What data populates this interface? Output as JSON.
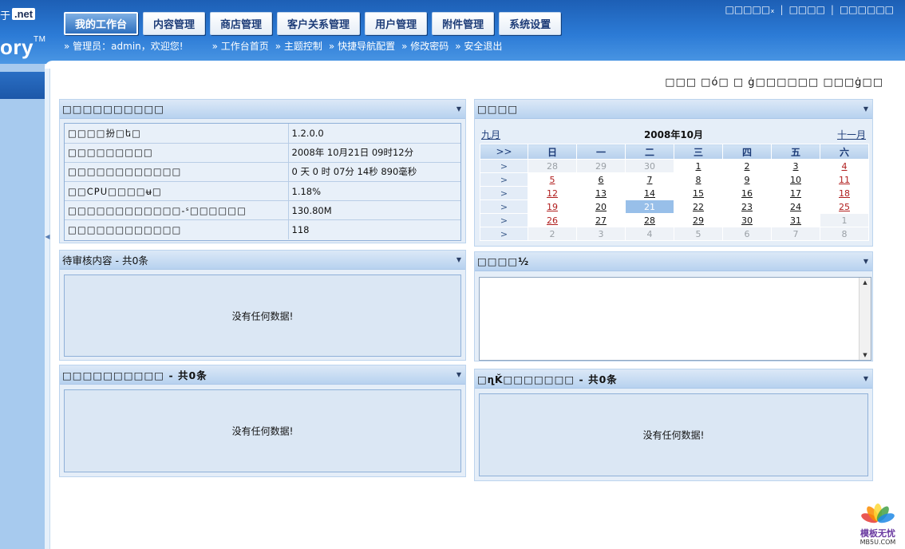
{
  "header": {
    "logo_char": "于",
    "logo_net": ".net",
    "logo_word": "ory",
    "logo_tm": "TM",
    "tabs": [
      {
        "label": "我的工作台",
        "active": true
      },
      {
        "label": "内容管理"
      },
      {
        "label": "商店管理"
      },
      {
        "label": "客户关系管理"
      },
      {
        "label": "用户管理"
      },
      {
        "label": "附件管理"
      },
      {
        "label": "系统设置"
      }
    ],
    "top_links": [
      "□□□□□ₓ",
      "□□□□",
      "□□□□□□"
    ],
    "greeting": "管理员：admin，欢迎您!",
    "sub_links": [
      "工作台首页",
      "主题控制",
      "快捷导航配置",
      "修改密码",
      "安全退出"
    ]
  },
  "top_right_info": "□□□ □ó□ □  ġ□□□□□□ □□□ġ□□",
  "system_info": {
    "title": "□□□□□□□□□□",
    "rows": [
      {
        "key": "□□□□扮□ե□",
        "value": "1.2.0.0"
      },
      {
        "key": "□□□□□□□□□",
        "value": "2008年 10月21日 09时12分"
      },
      {
        "key": "□□□□□□□□□□□□",
        "value": "0 天 0 时 07分 14秒 890毫秒"
      },
      {
        "key": "□□CPU□□□□ʉ□",
        "value": "1.18%"
      },
      {
        "key": "□□□□□□□□□□□□-ˢ□□□□□□",
        "value": "130.80M"
      },
      {
        "key": "□□□□□□□□□□□□",
        "value": "118"
      }
    ]
  },
  "calendar": {
    "title": "□□□□",
    "prev": "九月",
    "month_title": "2008年10月",
    "next": "十一月",
    "week_col": ">>",
    "week_marker": ">",
    "weekdays": [
      "日",
      "一",
      "二",
      "三",
      "四",
      "五",
      "六"
    ],
    "weeks": [
      [
        {
          "d": "28",
          "o": 1
        },
        {
          "d": "29",
          "o": 1
        },
        {
          "d": "30",
          "o": 1
        },
        {
          "d": "1"
        },
        {
          "d": "2"
        },
        {
          "d": "3"
        },
        {
          "d": "4"
        }
      ],
      [
        {
          "d": "5"
        },
        {
          "d": "6"
        },
        {
          "d": "7"
        },
        {
          "d": "8"
        },
        {
          "d": "9"
        },
        {
          "d": "10"
        },
        {
          "d": "11"
        }
      ],
      [
        {
          "d": "12"
        },
        {
          "d": "13"
        },
        {
          "d": "14"
        },
        {
          "d": "15"
        },
        {
          "d": "16"
        },
        {
          "d": "17"
        },
        {
          "d": "18"
        }
      ],
      [
        {
          "d": "19"
        },
        {
          "d": "20"
        },
        {
          "d": "21",
          "t": 1
        },
        {
          "d": "22"
        },
        {
          "d": "23"
        },
        {
          "d": "24"
        },
        {
          "d": "25"
        }
      ],
      [
        {
          "d": "26"
        },
        {
          "d": "27"
        },
        {
          "d": "28"
        },
        {
          "d": "29"
        },
        {
          "d": "30"
        },
        {
          "d": "31"
        },
        {
          "d": "1",
          "o": 1
        }
      ],
      [
        {
          "d": "2",
          "o": 1
        },
        {
          "d": "3",
          "o": 1
        },
        {
          "d": "4",
          "o": 1
        },
        {
          "d": "5",
          "o": 1
        },
        {
          "d": "6",
          "o": 1
        },
        {
          "d": "7",
          "o": 1
        },
        {
          "d": "8",
          "o": 1
        }
      ]
    ]
  },
  "pending": {
    "title": "待审核内容 - 共0条",
    "empty": "没有任何数据!"
  },
  "notes": {
    "title": "□□□□½",
    "value": ""
  },
  "panel_bl": {
    "title": "□□□□□□□□□□ - 共0条",
    "empty": "没有任何数据!"
  },
  "panel_br": {
    "title": "□ղǨ□□□□□□□ - 共0条",
    "empty": "没有任何数据!"
  },
  "watermark": {
    "name": "模板无忧",
    "url": "MB5U.COM"
  }
}
